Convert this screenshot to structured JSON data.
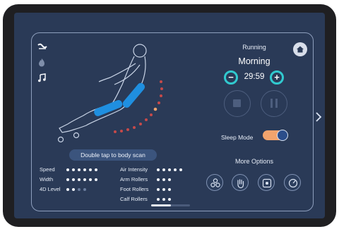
{
  "status": {
    "running_label": "Running",
    "program_name": "Morning",
    "timer": "29:59"
  },
  "controls": {
    "decrease_symbol": "−",
    "increase_symbol": "+"
  },
  "scan_button": {
    "label": "Double tap to body scan"
  },
  "settings_left": [
    {
      "label": "Speed",
      "level": 6,
      "max": 6
    },
    {
      "label": "Width",
      "level": 6,
      "max": 6
    },
    {
      "label": "4D Level",
      "level": 2,
      "max": 4
    }
  ],
  "settings_right": [
    {
      "label": "Air Intensity",
      "level": 5,
      "max": 5
    },
    {
      "label": "Arm Rollers",
      "level": 3,
      "max": 3
    },
    {
      "label": "Foot Rollers",
      "level": 3,
      "max": 3
    },
    {
      "label": "Calf Rollers",
      "level": 3,
      "max": 3
    }
  ],
  "sleep_mode": {
    "label": "Sleep Mode",
    "on": true
  },
  "more_options": {
    "label": "More Options"
  },
  "side_icons": [
    "massage-chair-icon",
    "heat-flame-icon",
    "music-note-icon"
  ],
  "option_icons": [
    "rollers-icon",
    "hand-massage-icon",
    "body-area-icon",
    "speed-dial-icon"
  ],
  "colors": {
    "accent": "#31c9cf",
    "toggle_track": "#f2a46d",
    "highlight": "#1f8fe0",
    "screen_bg": "#2a3a57"
  }
}
